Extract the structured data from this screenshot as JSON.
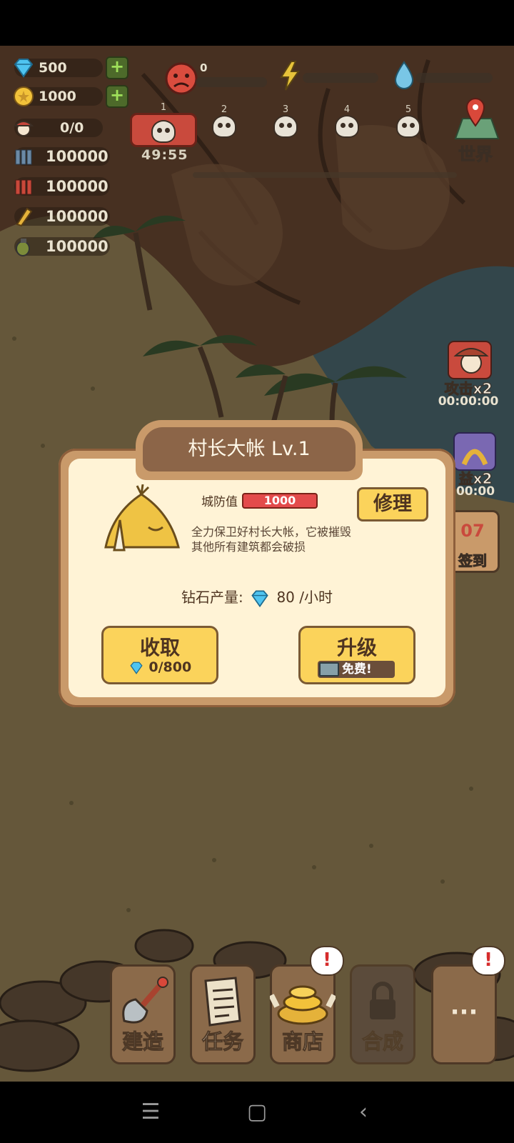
{
  "resources": {
    "diamonds": "500",
    "coins": "1000",
    "population": "0/0",
    "ammo_rows": [
      "100000",
      "100000",
      "100000",
      "100000"
    ]
  },
  "status_meters": {
    "mood_value": "0"
  },
  "waves": {
    "labels": [
      "1",
      "2",
      "3",
      "4",
      "5"
    ],
    "timer": "49:55",
    "world_label": "世界"
  },
  "side_buffs": {
    "attack_label": "攻击x2",
    "attack_timer": "00:00:00",
    "income_label": "益x2",
    "income_timer": "00:00",
    "checkin_day": "07",
    "checkin_label": "签到"
  },
  "modal": {
    "title": "村长大帐 Lv.1",
    "defense_label": "城防值",
    "defense_value": "1000",
    "repair_label": "修理",
    "description": "全力保卫好村长大帐，它被摧毁其他所有建筑都会破损",
    "production_label": "钻石产量:",
    "production_value": "80",
    "production_unit": "/小时",
    "collect_label": "收取",
    "collect_amount": "0/800",
    "upgrade_label": "升级",
    "upgrade_sub": "免费!"
  },
  "bottom_bar": {
    "build": "建造",
    "tasks": "任务",
    "shop": "商店",
    "merge": "合成",
    "more": "···",
    "alert": "!"
  },
  "colors": {
    "accent_yellow": "#fbd35b",
    "panel_cream": "#fff3d6",
    "panel_brown": "#c99a6a",
    "health_red": "#e34b4b"
  }
}
